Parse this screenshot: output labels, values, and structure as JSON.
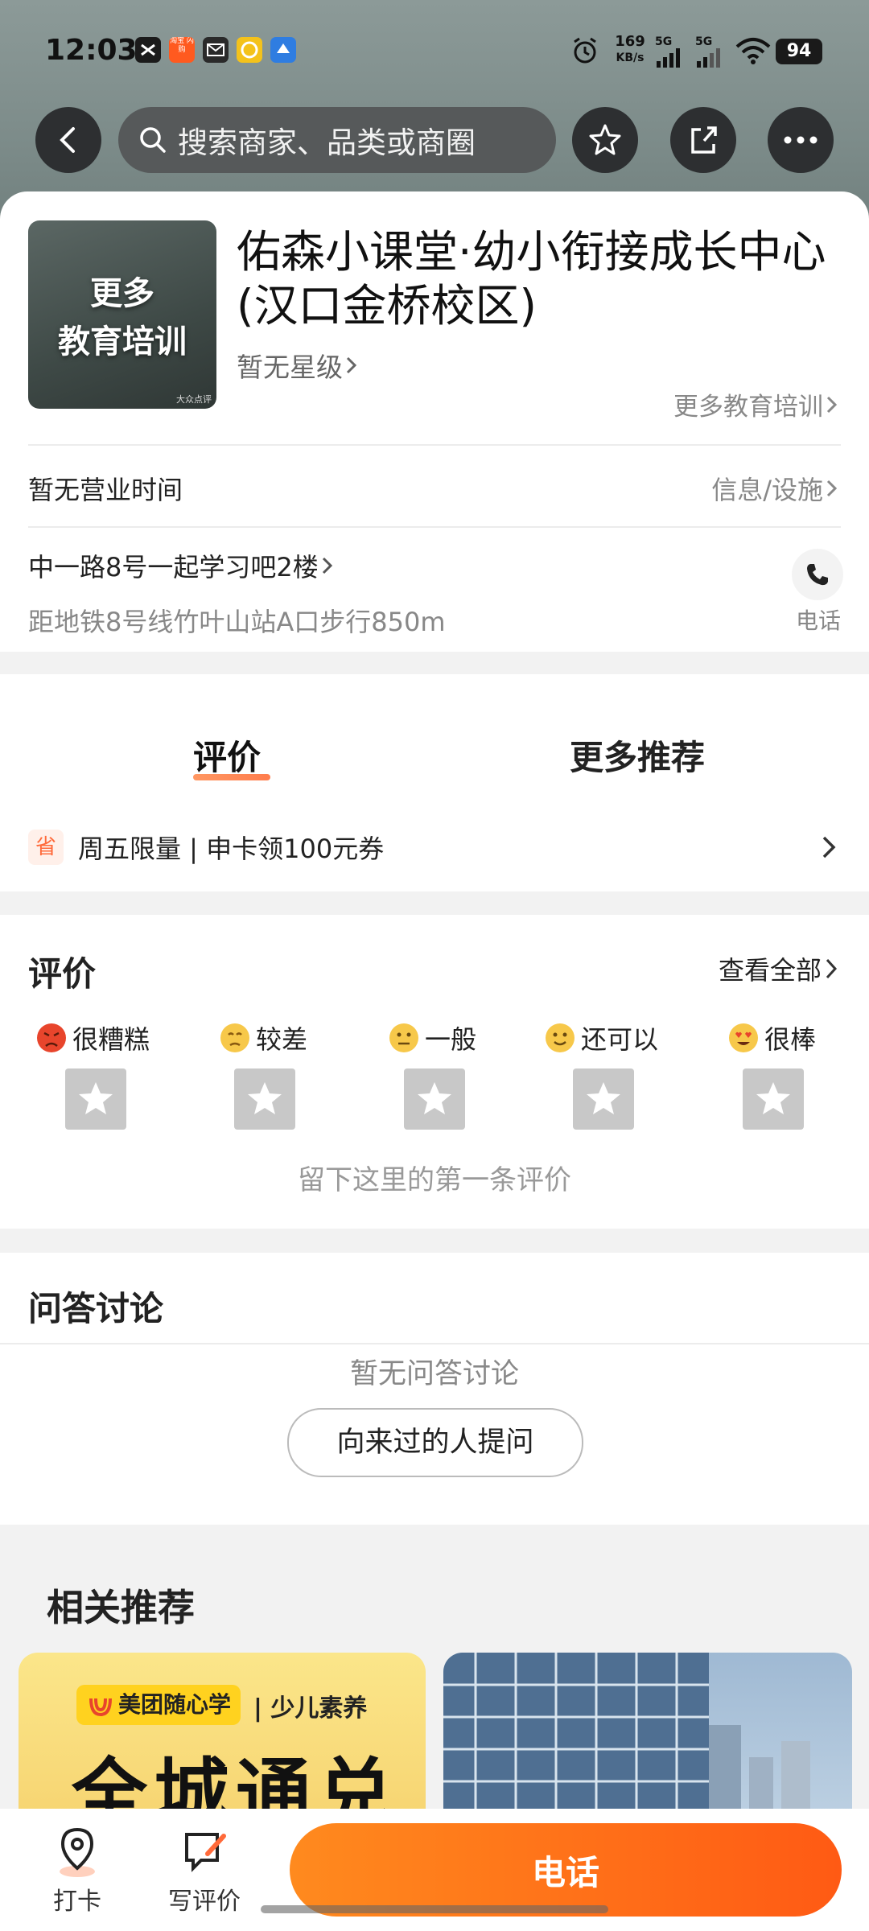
{
  "status_bar": {
    "time": "12:03",
    "net_speed": "169",
    "net_unit": "KB/s",
    "sig1": "5G",
    "sig2": "5G",
    "battery": "94",
    "app_badge": "淘宝 闪购"
  },
  "top_nav": {
    "search_placeholder": "搜索商家、品类或商圈"
  },
  "shop": {
    "thumb_line1": "更多",
    "thumb_line2": "教育培训",
    "thumb_watermark": "大众点评",
    "name": "佑森小课堂·幼小衔接成长中心(汉口金桥校区)",
    "rating": "暂无星级",
    "category_link": "更多教育培训",
    "hours": "暂无营业时间",
    "info_link": "信息/设施",
    "address": "中一路8号一起学习吧2楼",
    "metro": "距地铁8号线竹叶山站A口步行850m",
    "phone_label": "电话"
  },
  "tabs": {
    "review": "评价",
    "more": "更多推荐"
  },
  "promo": {
    "badge": "省",
    "text": "周五限量 | 申卡领100元券"
  },
  "reviews": {
    "title": "评价",
    "view_all": "查看全部",
    "levels": [
      "很糟糕",
      "较差",
      "一般",
      "还可以",
      "很棒"
    ],
    "empty_text": "留下这里的第一条评价"
  },
  "qa": {
    "title": "问答讨论",
    "empty": "暂无问答讨论",
    "ask_button": "向来过的人提问"
  },
  "related": {
    "title": "相关推荐",
    "card1_brand": "美团随心学",
    "card1_tag": "| 少儿素养",
    "card1_big": "全城通兑"
  },
  "bottom_bar": {
    "checkin": "打卡",
    "write_review": "写评价",
    "call": "电话"
  },
  "colors": {
    "accent": "#ff6a1a",
    "header_bg": "#7c8b89"
  }
}
